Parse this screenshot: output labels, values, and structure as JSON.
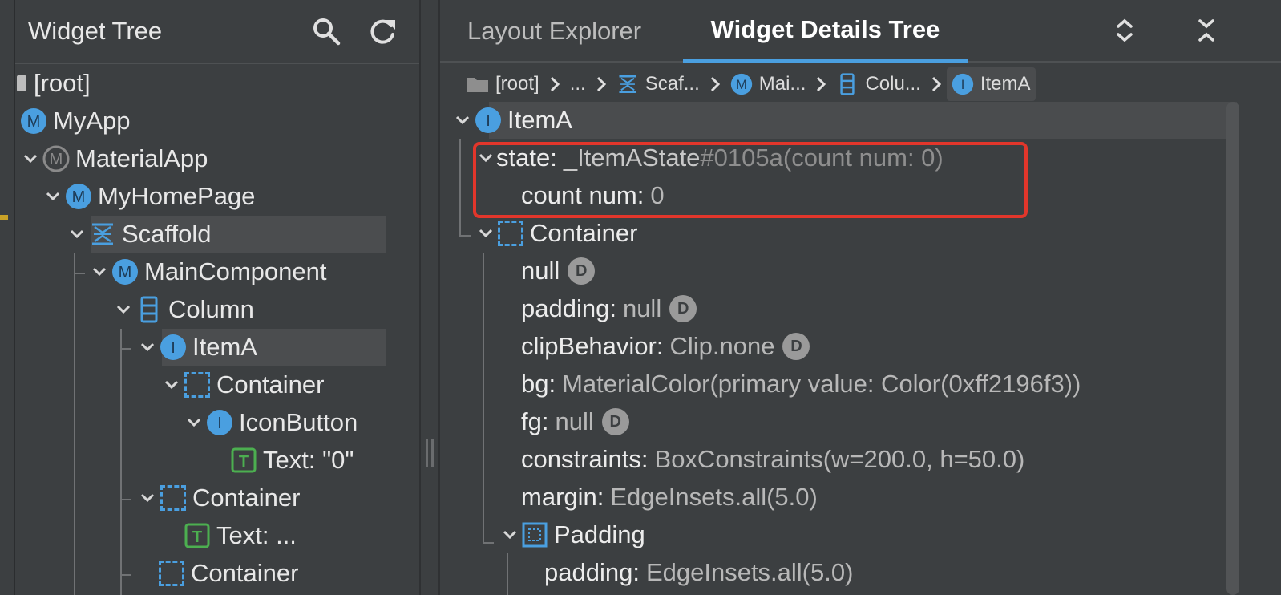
{
  "left_panel": {
    "title": "Widget Tree",
    "icons": [
      "search-icon",
      "refresh-icon"
    ],
    "tree": [
      {
        "label": "[root]",
        "icon": "root-square-icon"
      },
      {
        "label": "MyApp",
        "icon": "stateless-m-icon"
      },
      {
        "label": "MaterialApp",
        "icon": "material-app-icon"
      },
      {
        "label": "MyHomePage",
        "icon": "stateless-m-icon"
      },
      {
        "label": "Scaffold",
        "icon": "scaffold-icon"
      },
      {
        "label": "MainComponent",
        "icon": "stateless-m-icon"
      },
      {
        "label": "Column",
        "icon": "column-icon"
      },
      {
        "label": "ItemA",
        "icon": "stateful-i-icon"
      },
      {
        "label": "Container",
        "icon": "container-icon"
      },
      {
        "label": "IconButton",
        "icon": "stateful-i-icon"
      },
      {
        "label": "Text: \"0\"",
        "icon": "text-t-icon"
      },
      {
        "label": "Container",
        "icon": "container-icon"
      },
      {
        "label": "Text: ...",
        "icon": "text-t-icon"
      },
      {
        "label": "Container",
        "icon": "container-icon"
      }
    ]
  },
  "right_panel": {
    "tabs": [
      "Layout Explorer",
      "Widget Details Tree"
    ],
    "active_tab": "Widget Details Tree",
    "toolbar_icons": [
      "expand-collapse-icon",
      "collapse-all-icon"
    ],
    "breadcrumbs": [
      {
        "label": "[root]",
        "icon": "folder-icon"
      },
      {
        "label": "...",
        "icon": ""
      },
      {
        "label": "Scaf...",
        "icon": "scaffold-icon"
      },
      {
        "label": "Mai...",
        "icon": "stateless-m-icon"
      },
      {
        "label": "Colu...",
        "icon": "column-icon"
      },
      {
        "label": "ItemA",
        "icon": "stateful-i-icon"
      }
    ],
    "details": {
      "root_label": "ItemA",
      "state_key": "state:",
      "state_name": "_ItemAState",
      "state_suffix": "#0105a(count num: 0)",
      "count_key": "count num:",
      "count_val": "0",
      "container_label": "Container",
      "props": [
        {
          "key": "null",
          "val": "",
          "badge": "D"
        },
        {
          "key": "padding:",
          "val": "null",
          "badge": "D"
        },
        {
          "key": "clipBehavior:",
          "val": "Clip.none",
          "badge": "D"
        },
        {
          "key": "bg:",
          "val": "MaterialColor(primary value: Color(0xff2196f3))",
          "badge": ""
        },
        {
          "key": "fg:",
          "val": "null",
          "badge": "D"
        },
        {
          "key": "constraints:",
          "val": "BoxConstraints(w=200.0, h=50.0)",
          "badge": ""
        },
        {
          "key": "margin:",
          "val": "EdgeInsets.all(5.0)",
          "badge": ""
        }
      ],
      "padding_label": "Padding",
      "padding_prop_key": "padding:",
      "padding_prop_val": "EdgeInsets.all(5.0)"
    }
  },
  "colors": {
    "background": "#3c3f41",
    "accent_blue": "#4a9fe0",
    "highlight_red": "#e2362b",
    "text_green": "#4caf50"
  }
}
